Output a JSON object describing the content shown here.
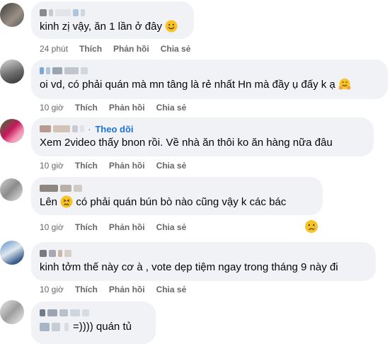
{
  "comments": [
    {
      "text": "kinh zị vậy, ăn 1 lần ở đây",
      "emoji": "smiling-face",
      "time": "24 phút",
      "like": "Thích",
      "reply": "Phản hồi",
      "share": "Chia sẻ"
    },
    {
      "text": "oi vd, có phải quán mà mn tâng là rẻ nhất Hn mà đầy ụ đấy k ạ",
      "emoji": "hugging-face",
      "time": "10 giờ",
      "like": "Thích",
      "reply": "Phản hồi",
      "share": "Chia sẻ"
    },
    {
      "follow": "Theo dõi",
      "text": "Xem 2video thấy bnon rồi. Về nhà ăn thôi ko ăn hàng nữa đâu",
      "time": "10 giờ",
      "like": "Thích",
      "reply": "Phản hồi",
      "share": "Chia sẻ"
    },
    {
      "text_before": "Lên",
      "emoji": "confounded-face",
      "text_after": "có phải quán bún bò nào cũng vậy k các bác",
      "reaction": "sad-face",
      "time": "10 giờ",
      "like": "Thích",
      "reply": "Phản hồi",
      "share": "Chia sẻ"
    },
    {
      "text": "kinh tởm thế này cơ à , vote dẹp tiệm ngay trong tháng 9 này đi",
      "time": "10 giờ",
      "like": "Thích",
      "reply": "Phản hồi",
      "share": "Chia sẻ"
    },
    {
      "text": "=)))) quán tủ"
    }
  ],
  "colors": {
    "bubble": "#f0f2f5",
    "text": "#050505",
    "secondary": "#65676b",
    "link": "#1c74d8"
  }
}
